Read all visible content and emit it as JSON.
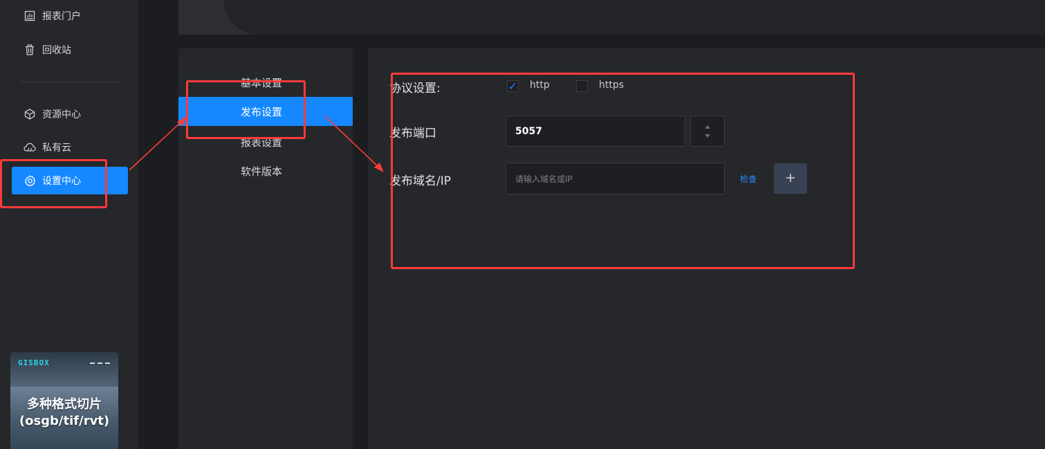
{
  "sidebar": {
    "items": [
      {
        "label": "报表门户",
        "icon": "report-chart-icon"
      },
      {
        "label": "回收站",
        "icon": "trash-icon"
      },
      {
        "label": "资源中心",
        "icon": "cube-icon"
      },
      {
        "label": "私有云",
        "icon": "cloud-icon"
      },
      {
        "label": "设置中心",
        "icon": "gear-icon",
        "active": true
      }
    ]
  },
  "promo": {
    "logo": "GISBOX",
    "title_line1": "多种格式切片",
    "title_line2": "(osgb/tif/rvt)"
  },
  "settings_nav": {
    "items": [
      {
        "label": "基本设置"
      },
      {
        "label": "发布设置",
        "active": true
      },
      {
        "label": "报表设置"
      },
      {
        "label": "软件版本"
      }
    ]
  },
  "publish": {
    "protocol_label": "协议设置:",
    "http_label": "http",
    "http_checked": true,
    "https_label": "https",
    "https_checked": false,
    "port_label": "发布端口",
    "port_value": "5057",
    "domain_label": "发布域名/IP",
    "domain_placeholder": "请输入域名或IP",
    "check_label": "检查",
    "add_label": "+"
  },
  "colors": {
    "accent": "#1688ff",
    "annotation": "#ff3b3b",
    "background": "#1c1d21",
    "panel": "#26272b"
  }
}
